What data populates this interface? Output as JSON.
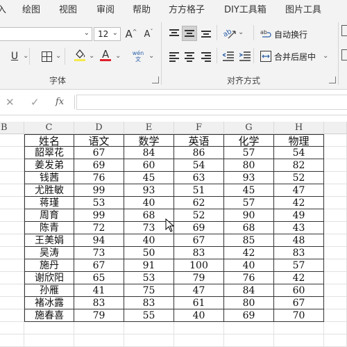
{
  "ribbon_tabs": [
    "入",
    "绘图",
    "视图",
    "审阅",
    "帮助",
    "方方格子",
    "DIY工具箱",
    "图片工具"
  ],
  "font_group": {
    "label": "字体",
    "font_name": "",
    "font_size": "12",
    "grow_font": "A",
    "shrink_font": "A",
    "underline": "U",
    "font_color_letter": "A",
    "phonetic": "wén 文",
    "font_color": "#e0202a",
    "fill_color": "#f5e94b"
  },
  "align_group": {
    "label": "对齐方式",
    "wrap_text": "自动换行",
    "merge_center": "合并后居中"
  },
  "formula_bar": {
    "cancel": "✕",
    "enter": "✓",
    "fx": "fx",
    "value": ""
  },
  "grid": {
    "column_letters": [
      "B",
      "C",
      "D",
      "E",
      "F",
      "G",
      "H"
    ],
    "headers": [
      "姓名",
      "语文",
      "数学",
      "英语",
      "化学",
      "物理"
    ],
    "rows": [
      [
        "韶翠花",
        "67",
        "84",
        "86",
        "57",
        "54"
      ],
      [
        "姜发弟",
        "69",
        "60",
        "54",
        "80",
        "82"
      ],
      [
        "钱茜",
        "76",
        "45",
        "63",
        "93",
        "52"
      ],
      [
        "尤胜敏",
        "99",
        "93",
        "51",
        "45",
        "47"
      ],
      [
        "蒋瑾",
        "53",
        "40",
        "62",
        "57",
        "42"
      ],
      [
        "周育",
        "99",
        "68",
        "52",
        "90",
        "49"
      ],
      [
        "陈青",
        "72",
        "73",
        "69",
        "68",
        "43"
      ],
      [
        "王美娟",
        "94",
        "40",
        "67",
        "85",
        "48"
      ],
      [
        "吴涛",
        "73",
        "50",
        "83",
        "42",
        "83"
      ],
      [
        "施丹",
        "67",
        "91",
        "100",
        "40",
        "57"
      ],
      [
        "谢欣阳",
        "65",
        "53",
        "79",
        "76",
        "42"
      ],
      [
        "孙雁",
        "41",
        "75",
        "47",
        "84",
        "60"
      ],
      [
        "褚冰露",
        "83",
        "83",
        "61",
        "80",
        "67"
      ],
      [
        "施春喜",
        "79",
        "55",
        "40",
        "69",
        "70"
      ]
    ]
  }
}
